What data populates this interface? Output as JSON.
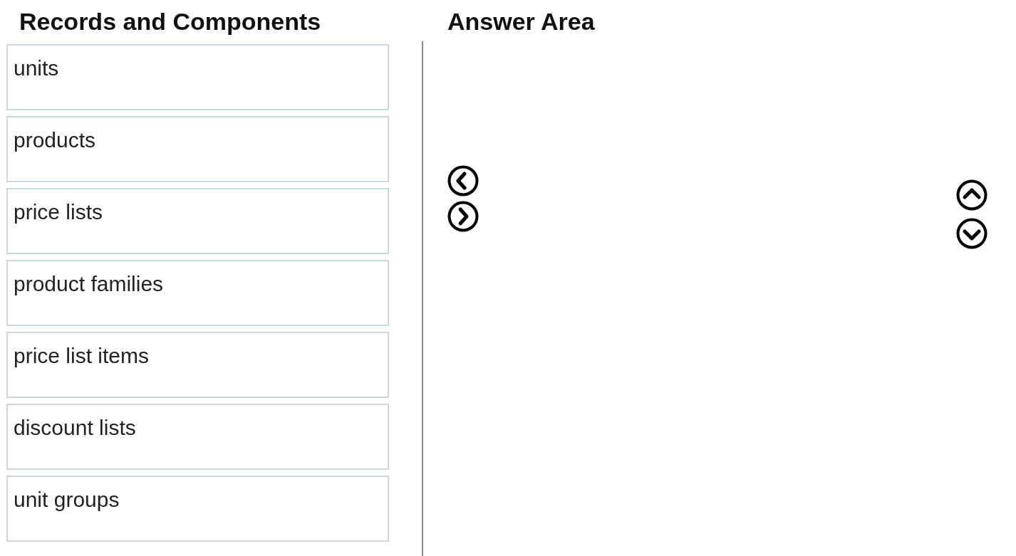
{
  "source_panel": {
    "heading": "Records and Components",
    "items": [
      {
        "label": "units"
      },
      {
        "label": "products"
      },
      {
        "label": "price lists"
      },
      {
        "label": "product families"
      },
      {
        "label": "price list items"
      },
      {
        "label": "discount lists"
      },
      {
        "label": "unit groups"
      }
    ]
  },
  "answer_panel": {
    "heading": "Answer Area"
  }
}
